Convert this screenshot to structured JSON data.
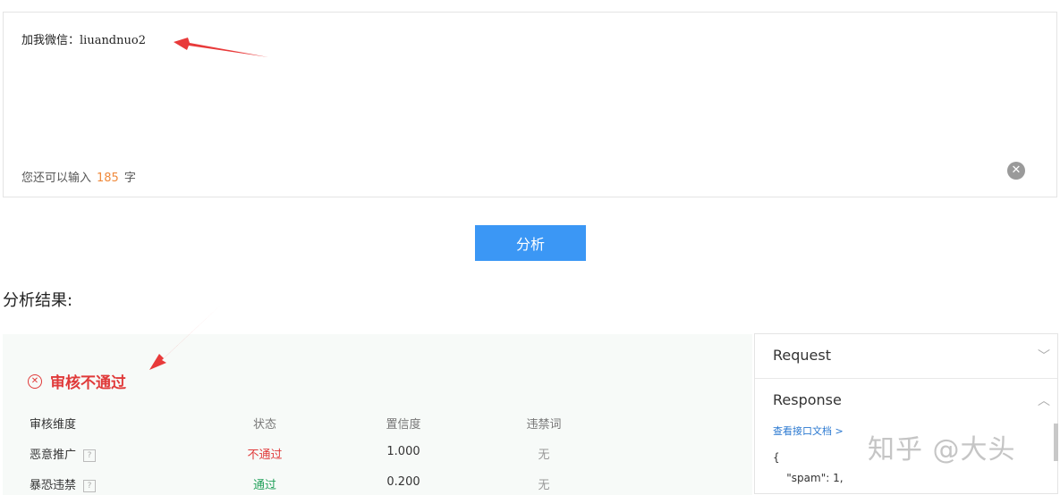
{
  "input": {
    "text": "加我微信：liuandnuo2",
    "counter_prefix": "您还可以输入",
    "counter_value": "185",
    "counter_suffix": "字",
    "clear_icon": "close-circle-icon"
  },
  "analyze_button": {
    "label": "分析"
  },
  "results": {
    "title": "分析结果:",
    "verdict": "审核不通过",
    "verdict_icon": "x-circle-icon",
    "columns": [
      "审核维度",
      "状态",
      "置信度",
      "违禁词"
    ],
    "rows": [
      {
        "dimension": "恶意推广",
        "status": "不通过",
        "confidence": "1.000",
        "words": "无"
      },
      {
        "dimension": "暴恐违禁",
        "status": "通过",
        "confidence": "0.200",
        "words": "无"
      }
    ]
  },
  "side_panel": {
    "request_label": "Request",
    "response_label": "Response",
    "doc_link": "查看接口文档 >",
    "code_line1": "{",
    "code_line2": "    \"spam\": 1,"
  },
  "watermark": "知乎 @大头",
  "colors": {
    "primary_button": "#3b97f5",
    "fail": "#e03a3a",
    "pass": "#22a05a",
    "counter_number": "#f08a3c",
    "arrow": "#e83a3a"
  }
}
